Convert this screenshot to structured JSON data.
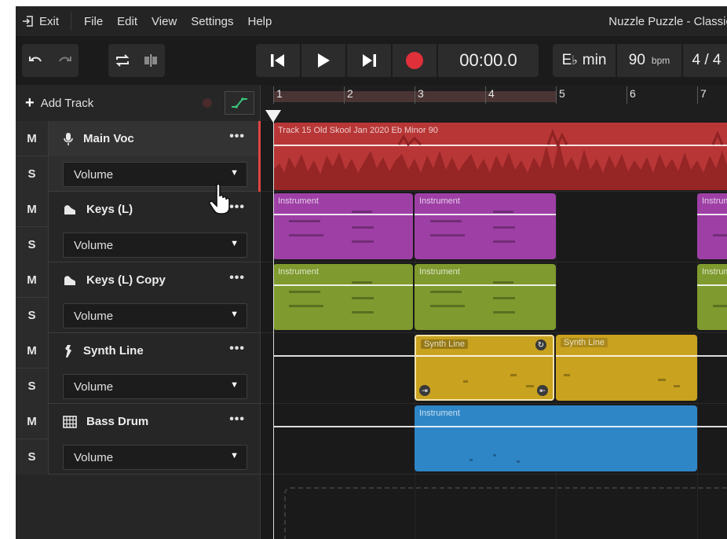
{
  "menu": {
    "exit_label": "Exit",
    "items": [
      "File",
      "Edit",
      "View",
      "Settings",
      "Help"
    ],
    "project_title": "Nuzzle Puzzle - Classic"
  },
  "toolbar": {
    "time": "00:00.0",
    "key_prefix": "E",
    "key_accidental": "♭",
    "key_mode": "min",
    "tempo": "90",
    "tempo_unit": "bpm",
    "time_signature": "4 / 4",
    "record_color": "#e0303a"
  },
  "tracks_panel": {
    "add_track_label": "Add Track",
    "tracks": [
      {
        "name": "Main Voc",
        "icon": "microphone-icon",
        "mute": "M",
        "solo": "S",
        "param": "Volume",
        "color": "#c23c3c"
      },
      {
        "name": "Keys (L)",
        "icon": "piano-icon",
        "mute": "M",
        "solo": "S",
        "param": "Volume",
        "color": "#9e3fa6"
      },
      {
        "name": "Keys (L) Copy",
        "icon": "piano-icon",
        "mute": "M",
        "solo": "S",
        "param": "Volume",
        "color": "#7f9a2e"
      },
      {
        "name": "Synth Line",
        "icon": "synth-icon",
        "mute": "M",
        "solo": "S",
        "param": "Volume",
        "color": "#c9a21f"
      },
      {
        "name": "Bass Drum",
        "icon": "drum-grid-icon",
        "mute": "M",
        "solo": "S",
        "param": "Volume",
        "color": "#2f86c6"
      }
    ]
  },
  "timeline": {
    "bars": [
      "1",
      "2",
      "3",
      "4",
      "5",
      "6",
      "7"
    ],
    "clips": {
      "audio": "Track 15 Old Skool Jan 2020 Eb Minor 90",
      "instrument": "Instrument",
      "synth": "Synth Line"
    }
  }
}
